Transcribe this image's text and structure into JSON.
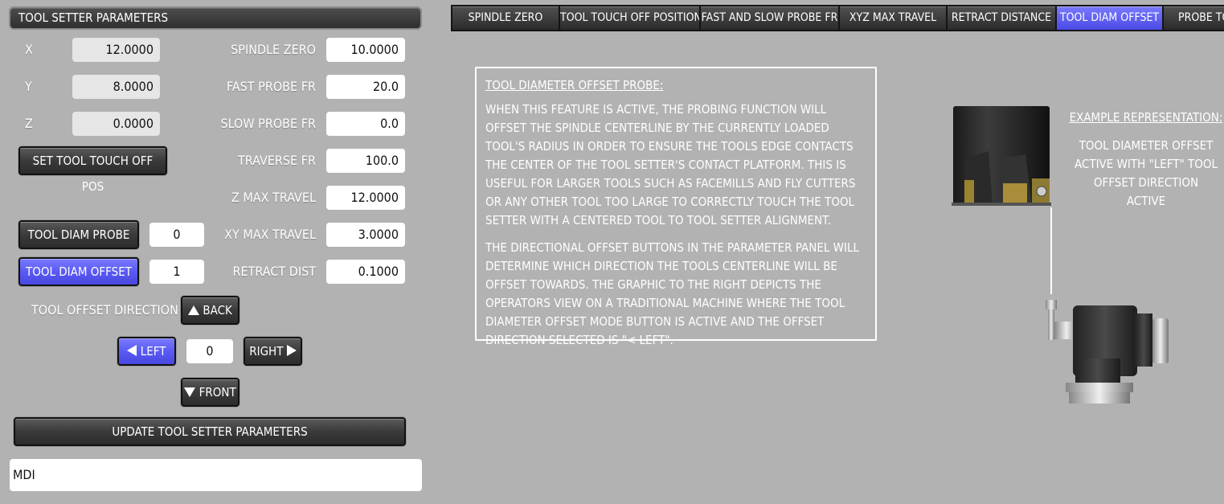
{
  "panel": {
    "title": "TOOL SETTER PARAMETERS"
  },
  "axes": [
    {
      "label": "X",
      "value": "12.0000"
    },
    {
      "label": "Y",
      "value": "8.0000"
    },
    {
      "label": "Z",
      "value": "0.0000"
    }
  ],
  "params": [
    {
      "label": "SPINDLE ZERO",
      "value": "10.0000"
    },
    {
      "label": "FAST PROBE FR",
      "value": "20.0"
    },
    {
      "label": "SLOW PROBE FR",
      "value": "0.0"
    },
    {
      "label": "TRAVERSE FR",
      "value": "100.0"
    },
    {
      "label": "Z MAX TRAVEL",
      "value": "12.0000"
    },
    {
      "label": "XY MAX TRAVEL",
      "value": "3.0000"
    },
    {
      "label": "RETRACT DIST",
      "value": "0.1000"
    }
  ],
  "buttons": {
    "set_touch_off": "SET TOOL TOUCH OFF POS",
    "tool_diam_probe": "TOOL DIAM PROBE",
    "tool_diam_probe_value": "0",
    "tool_diam_offset": "TOOL DIAM OFFSET",
    "tool_diam_offset_value": "1",
    "update": "UPDATE TOOL SETTER PARAMETERS"
  },
  "direction": {
    "label": "TOOL OFFSET DIRECTION",
    "back": "BACK",
    "left": "LEFT",
    "right": "RIGHT",
    "front": "FRONT",
    "value": "0"
  },
  "mdi": {
    "value": "MDI"
  },
  "tabs": [
    {
      "label": "SPINDLE ZERO",
      "active": false
    },
    {
      "label": "TOOL TOUCH OFF POSITION",
      "active": false
    },
    {
      "label": "FAST AND SLOW PROBE FR",
      "active": false
    },
    {
      "label": "XYZ MAX TRAVEL",
      "active": false
    },
    {
      "label": "RETRACT DISTANCE",
      "active": false
    },
    {
      "label": "TOOL DIAM OFFSET",
      "active": true
    },
    {
      "label": "PROBE TOOL",
      "active": false
    }
  ],
  "info": {
    "title": "TOOL DIAMETER OFFSET PROBE:",
    "p1": "WHEN THIS FEATURE IS ACTIVE, THE PROBING FUNCTION WILL OFFSET THE SPINDLE CENTERLINE BY THE CURRENTLY LOADED TOOL'S RADIUS IN ORDER TO ENSURE THE TOOLS EDGE CONTACTS THE CENTER OF THE TOOL SETTER'S CONTACT PLATFORM. THIS IS USEFUL FOR LARGER TOOLS SUCH AS FACEMILLS AND FLY CUTTERS OR ANY OTHER TOOL TOO LARGE TO CORRECTLY TOUCH THE TOOL SETTER WITH A CENTERED TOOL TO TOOL SETTER ALIGNMENT.",
    "p2": "THE DIRECTIONAL OFFSET BUTTONS IN THE PARAMETER PANEL WILL DETERMINE WHICH DIRECTION THE TOOLS CENTERLINE WILL BE OFFSET TOWARDS. THE GRAPHIC TO THE RIGHT DEPICTS THE OPERATORS VIEW ON A TRADITIONAL MACHINE WHERE THE TOOL DIAMETER OFFSET MODE BUTTON IS ACTIVE AND THE OFFSET DIRECTION SELECTED IS \"< LEFT\"."
  },
  "example": {
    "title": "EXAMPLE REPRESENTATION:",
    "body": "TOOL DIAMETER OFFSET ACTIVE WITH \"LEFT\" TOOL OFFSET DIRECTION ACTIVE"
  },
  "colors": {
    "active_blue": "#5a5af5",
    "panel_bg": "#b2b2b2"
  }
}
